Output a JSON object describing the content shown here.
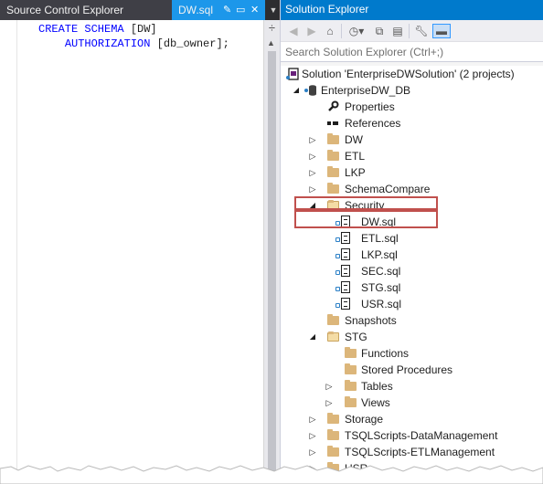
{
  "editor": {
    "tabs": {
      "source_control_label": "Source Control Explorer",
      "active_file_label": "DW.sql"
    },
    "code_lines": [
      {
        "kw1": "CREATE SCHEMA",
        "rest1": " [DW]"
      },
      {
        "kw1": "AUTHORIZATION",
        "rest1": " [db_owner];"
      }
    ]
  },
  "solution_explorer": {
    "title": "Solution Explorer",
    "search_placeholder": "Search Solution Explorer (Ctrl+;)",
    "solution_label": "Solution 'EnterpriseDWSolution' (2 projects)",
    "project_label": "EnterpriseDW_DB",
    "items": {
      "properties": "Properties",
      "references": "References",
      "dw": "DW",
      "etl": "ETL",
      "lkp": "LKP",
      "schema_compare": "SchemaCompare",
      "security": "Security",
      "security_files": [
        "DW.sql",
        "ETL.sql",
        "LKP.sql",
        "SEC.sql",
        "STG.sql",
        "USR.sql"
      ],
      "snapshots": "Snapshots",
      "stg": "STG",
      "stg_children": [
        "Functions",
        "Stored Procedures",
        "Tables",
        "Views"
      ],
      "storage": "Storage",
      "tsql_data_mgmt": "TSQLScripts-DataManagement",
      "tsql_etl_mgmt": "TSQLScripts-ETLManagement",
      "usr_partial": "USR"
    }
  },
  "icons": {
    "back": "back-arrow-icon",
    "forward": "forward-arrow-icon",
    "home": "home-icon",
    "history": "history-icon",
    "collapse": "collapse-all-icon",
    "show_all": "show-all-files-icon",
    "properties": "wrench-icon",
    "preview": "preview-pin-icon"
  },
  "colors": {
    "title_bar": "#007acc",
    "active_tab": "#1c97ea",
    "highlight_border": "#c0504d",
    "keyword": "#0000ff",
    "folder": "#dcb67a"
  }
}
